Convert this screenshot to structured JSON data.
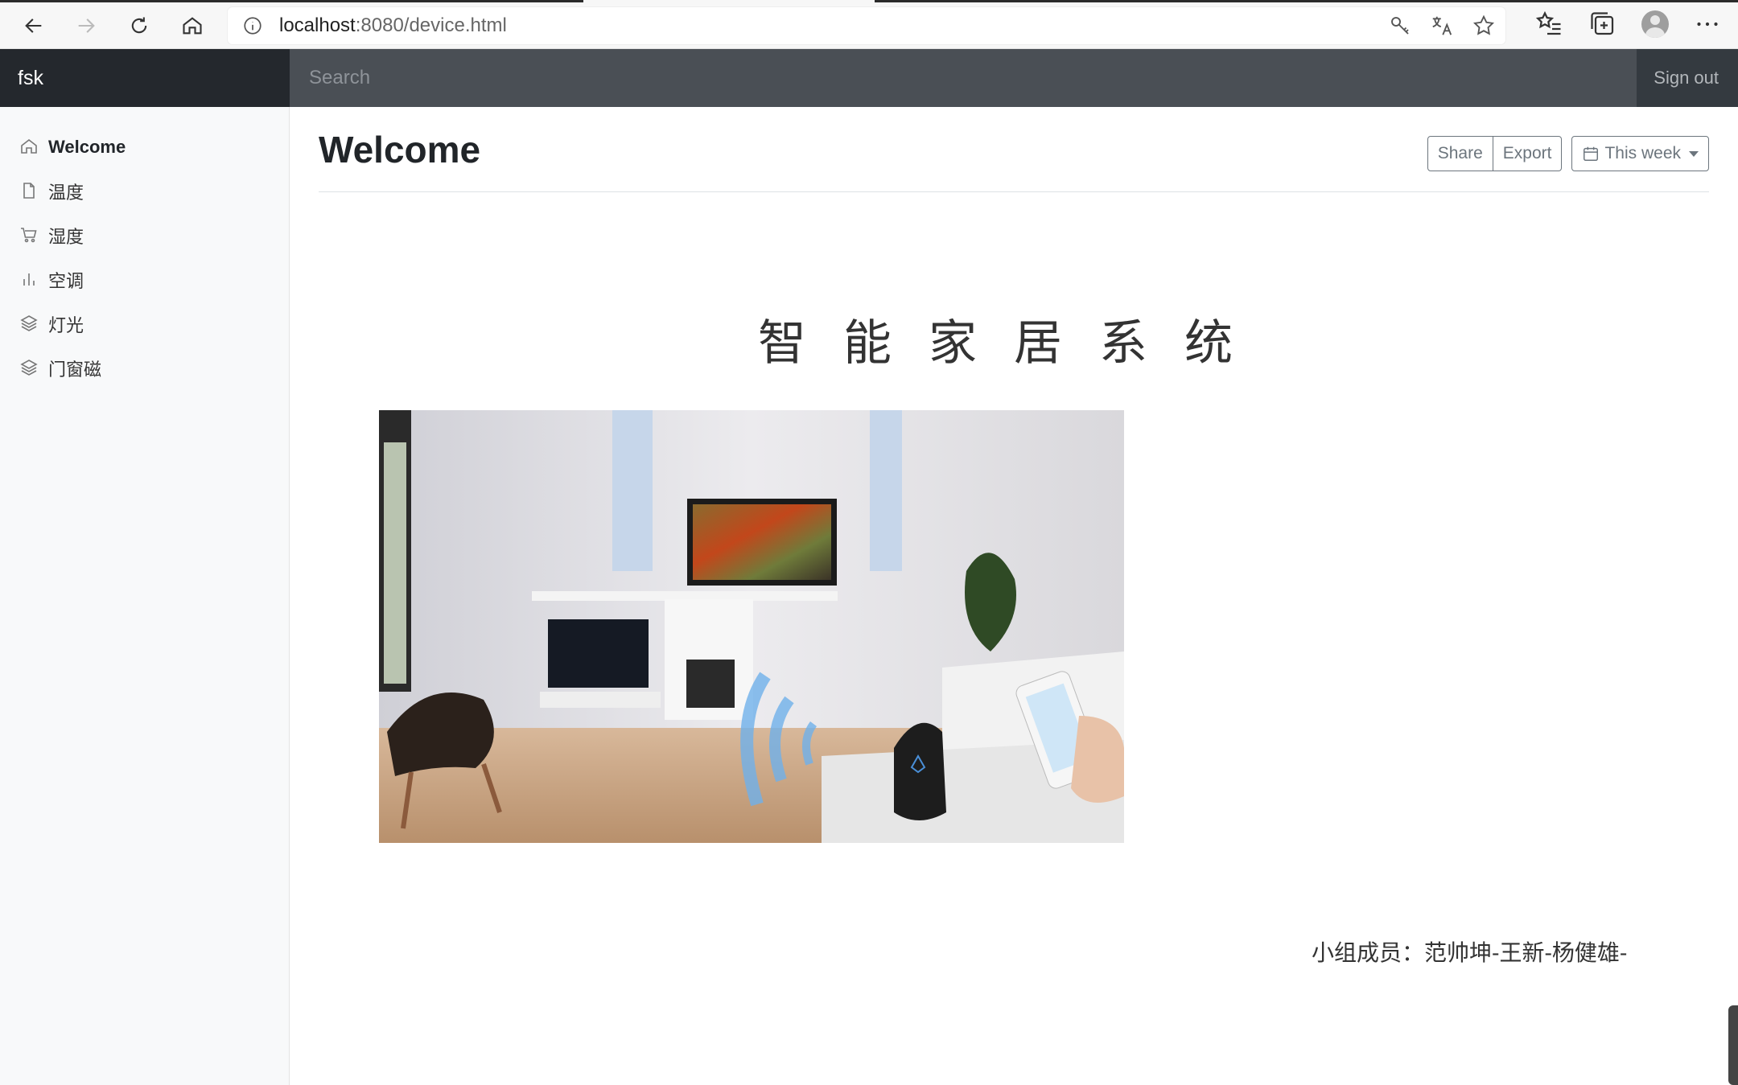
{
  "browser": {
    "url_host": "localhost",
    "url_path": ":8080/device.html"
  },
  "navbar": {
    "brand": "fsk",
    "search_placeholder": "Search",
    "signout_label": "Sign out"
  },
  "sidebar": {
    "items": [
      {
        "label": "Welcome",
        "icon": "home-icon",
        "active": true
      },
      {
        "label": "温度",
        "icon": "file-icon"
      },
      {
        "label": "湿度",
        "icon": "cart-icon"
      },
      {
        "label": "空调",
        "icon": "bar-chart-icon"
      },
      {
        "label": "灯光",
        "icon": "layers-icon"
      },
      {
        "label": "门窗磁",
        "icon": "layers-icon"
      }
    ]
  },
  "main": {
    "title": "Welcome",
    "toolbar": {
      "share_label": "Share",
      "export_label": "Export",
      "range_label": "This week"
    },
    "hero_title": "智能家居系统",
    "members_text": "小组成员：范帅坤-王新-杨健雄-"
  },
  "colors": {
    "navbar_bg": "#343a40",
    "brand_bg": "#24282d",
    "search_bg": "#4a4f55",
    "sidebar_bg": "#f8f9fa",
    "btn_border": "#6c757d"
  }
}
